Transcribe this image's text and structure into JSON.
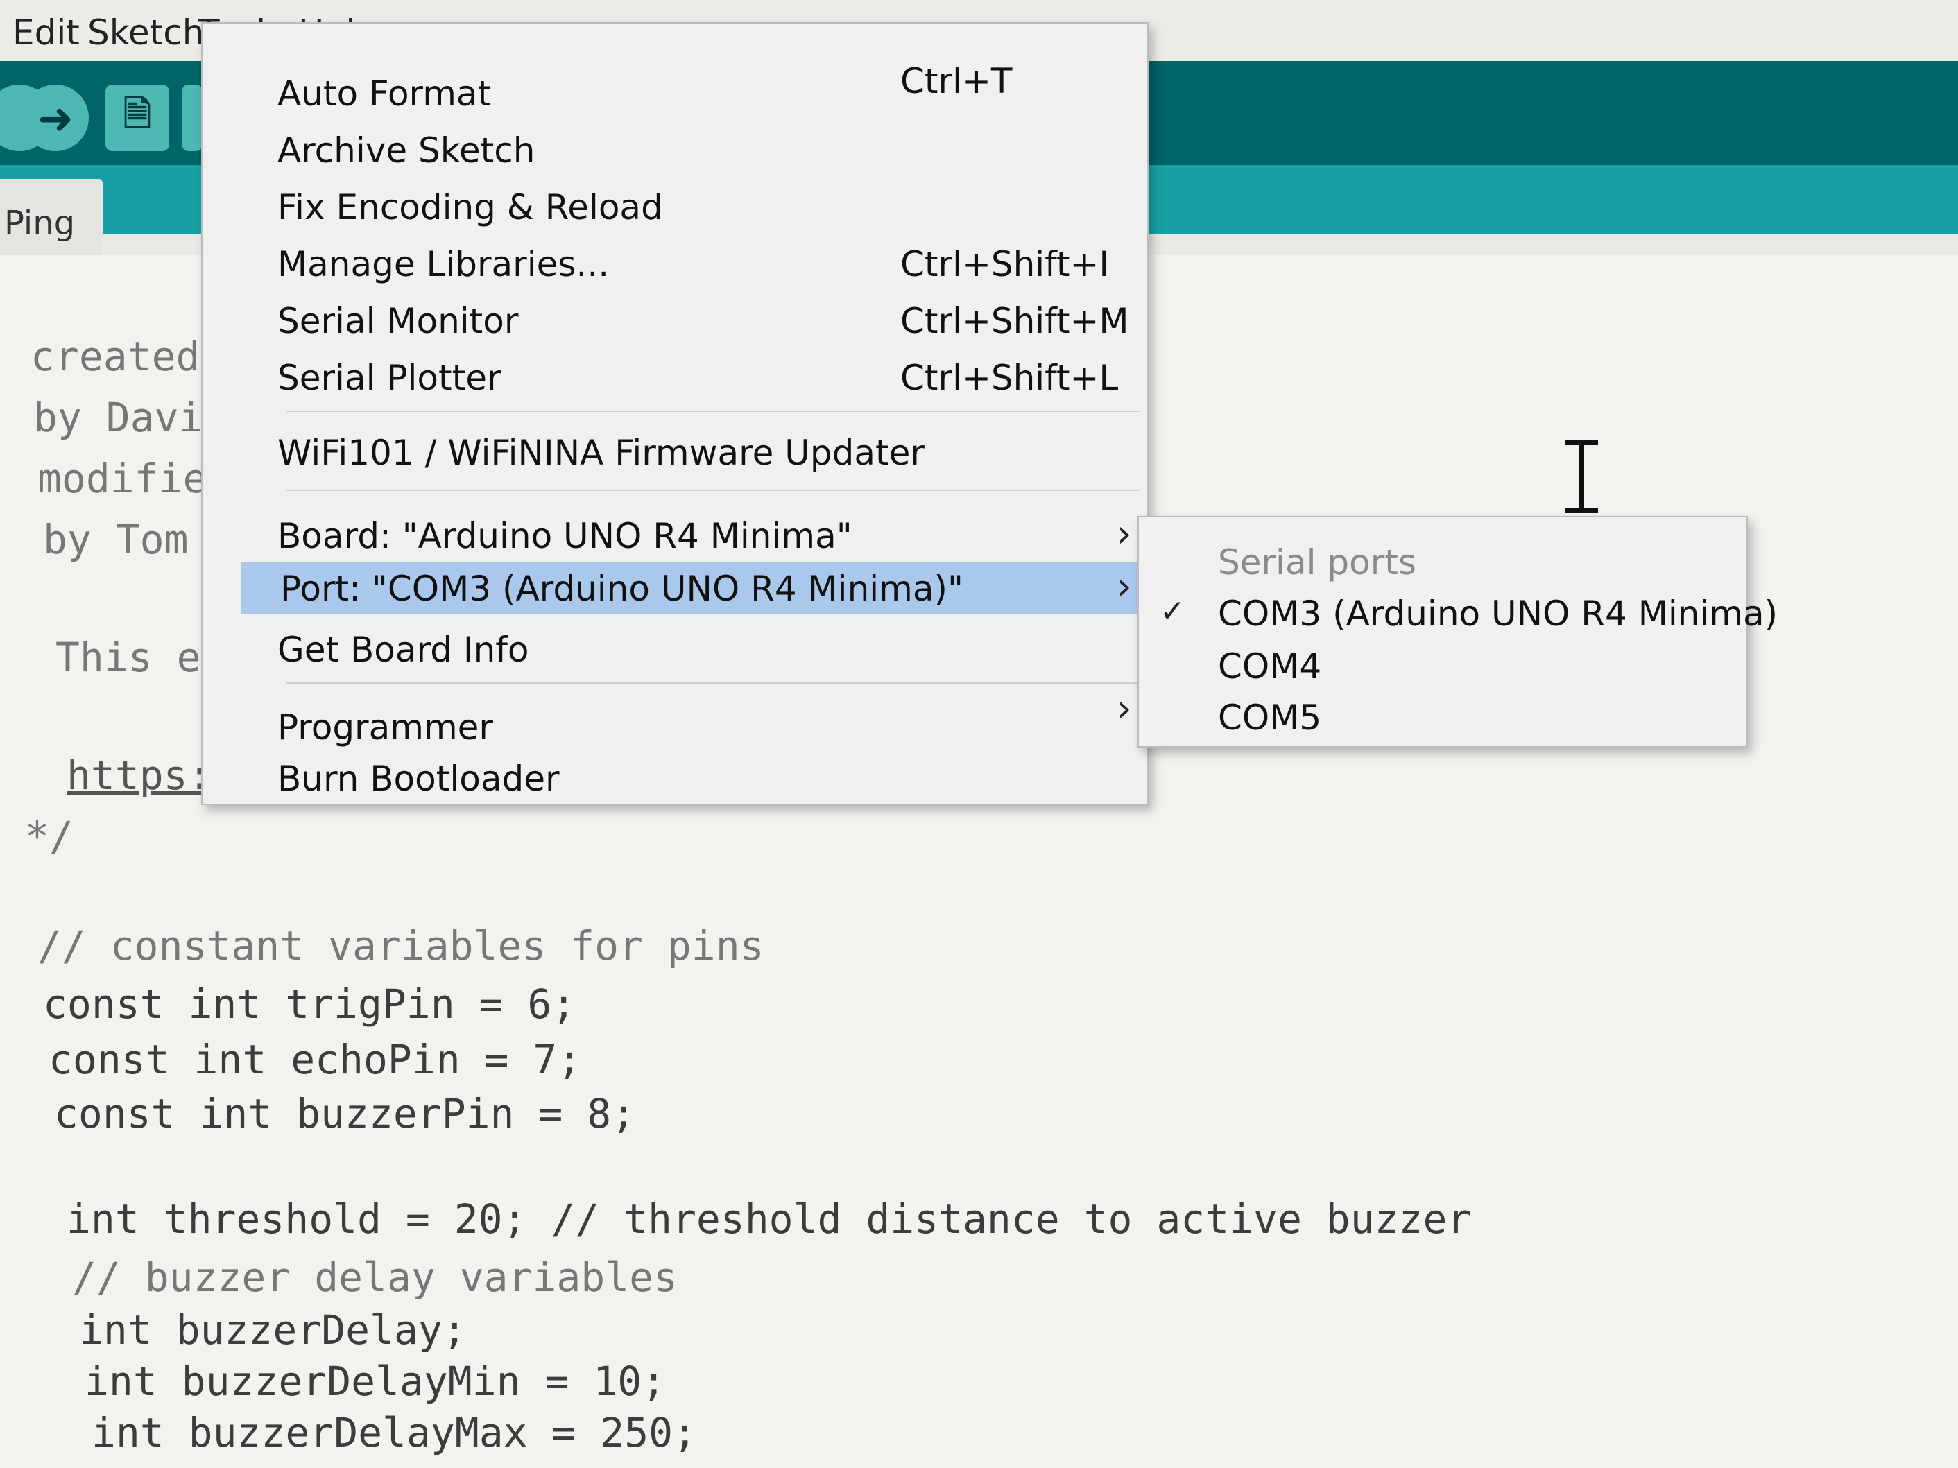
{
  "menubar": {
    "items": [
      "Edit",
      "Sketch",
      "Tools",
      "Help"
    ]
  },
  "tab": {
    "label": "Ping"
  },
  "editor": {
    "lines": [
      "created",
      "by Davi",
      "modifie",
      "by Tom",
      "This ex",
      "https:/",
      "*/",
      "// constant variables for pins",
      "const int trigPin = 6;",
      "const int echoPin = 7;",
      "const int buzzerPin = 8;",
      "int threshold = 20; // threshold distance to active buzzer",
      "// buzzer delay variables",
      "int buzzerDelay;",
      "int buzzerDelayMin = 10;",
      "int buzzerDelayMax = 250;"
    ]
  },
  "tools_menu": {
    "items": [
      {
        "label": "Auto Format",
        "shortcut": "Ctrl+T"
      },
      {
        "label": "Archive Sketch",
        "shortcut": ""
      },
      {
        "label": "Fix Encoding & Reload",
        "shortcut": ""
      },
      {
        "label": "Manage Libraries...",
        "shortcut": "Ctrl+Shift+I"
      },
      {
        "label": "Serial Monitor",
        "shortcut": "Ctrl+Shift+M"
      },
      {
        "label": "Serial Plotter",
        "shortcut": "Ctrl+Shift+L"
      },
      {
        "label": "WiFi101 / WiFiNINA Firmware Updater",
        "shortcut": ""
      },
      {
        "label": "Board: \"Arduino UNO R4 Minima\"",
        "shortcut": "",
        "submenu": true
      },
      {
        "label": "Port: \"COM3 (Arduino UNO R4 Minima)\"",
        "shortcut": "",
        "submenu": true,
        "highlighted": true
      },
      {
        "label": "Get Board Info",
        "shortcut": ""
      },
      {
        "label": "Programmer",
        "shortcut": "",
        "submenu": true
      },
      {
        "label": "Burn Bootloader",
        "shortcut": ""
      }
    ]
  },
  "port_submenu": {
    "header": "Serial ports",
    "items": [
      {
        "label": "COM3 (Arduino UNO R4 Minima)",
        "checked": true
      },
      {
        "label": "COM4",
        "checked": false
      },
      {
        "label": "COM5",
        "checked": false
      }
    ]
  },
  "icons": {
    "upload": "arrow-right-icon",
    "new": "document-icon",
    "check": "checkmark-icon",
    "submenu": "chevron-right-icon",
    "cursor": "text-cursor-icon"
  },
  "colors": {
    "toolbar": "#006468",
    "header_band": "#17a1a5",
    "menu_highlight": "#a9c8ec"
  }
}
